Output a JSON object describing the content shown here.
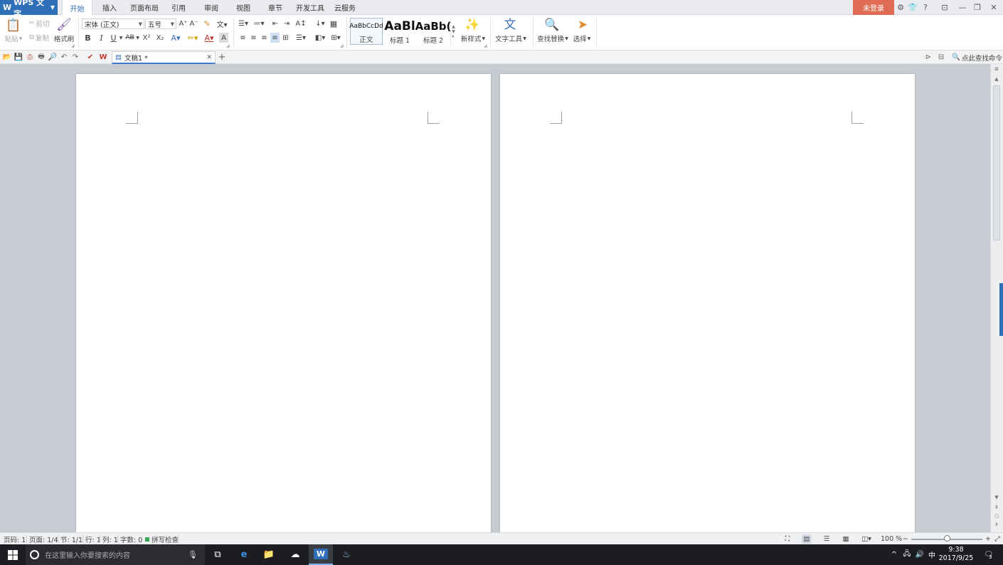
{
  "app": {
    "name": "WPS 文字",
    "logo": "W"
  },
  "menu_tabs": [
    "开始",
    "插入",
    "页面布局",
    "引用",
    "审阅",
    "视图",
    "章节",
    "开发工具",
    "云服务"
  ],
  "titlebar": {
    "login_label": "未登录",
    "help_label": "?"
  },
  "ribbon": {
    "paste_label": "粘贴",
    "cut_label": "剪切",
    "copy_label": "复制",
    "format_painter_label": "格式刷",
    "font_name": "宋体 (正文)",
    "font_size": "五号",
    "bold": "B",
    "italic": "I",
    "underline": "U",
    "strike": "AB",
    "superscript": "X²",
    "subscript": "X₂",
    "styles": [
      {
        "sample": "AaBbCcDd",
        "name": "正文"
      },
      {
        "sample": "AaBl",
        "name": "标题 1"
      },
      {
        "sample": "AaBb(",
        "name": "标题 2"
      }
    ],
    "new_style_label": "新样式",
    "text_tools_label": "文字工具",
    "find_replace_label": "查找替换",
    "select_label": "选择"
  },
  "quickbar": {
    "doc_tab_label": "文稿1 *",
    "find_command_label": "点此查找命令"
  },
  "statusbar": {
    "page_num": "页码: 1",
    "page": "页面: 1/4",
    "section": "节: 1/1",
    "row": "行: 1",
    "col": "列: 1",
    "word_count": "字数: 0",
    "spell_check": "拼写检查",
    "zoom": "100 %"
  },
  "taskbar": {
    "search_placeholder": "在这里输入你要搜索的内容",
    "ime": "中",
    "time": "9:38",
    "date": "2017/9/25",
    "notification_count": "3"
  },
  "colors": {
    "accent": "#2f6fb8",
    "login_bg": "#e06b55",
    "taskbar_bg": "#1c1d21"
  }
}
